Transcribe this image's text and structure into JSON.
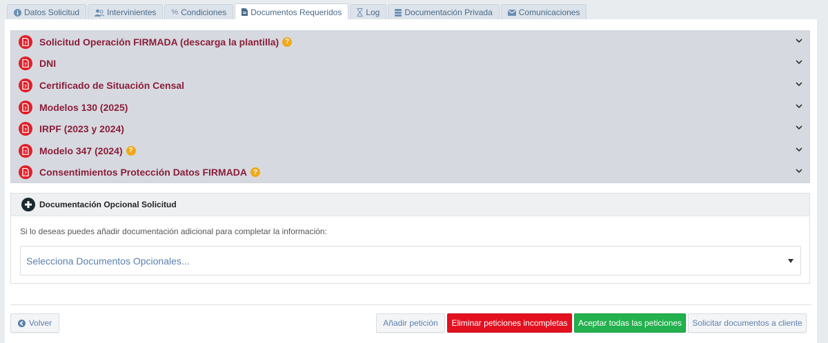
{
  "tabs": [
    {
      "label": "Datos Solicitud",
      "icon": "info-icon"
    },
    {
      "label": "Intervinientes",
      "icon": "users-icon"
    },
    {
      "label": "Condiciones",
      "icon": "percent-icon"
    },
    {
      "label": "Documentos Requeridos",
      "icon": "file-icon"
    },
    {
      "label": "Log",
      "icon": "hourglass-icon"
    },
    {
      "label": "Documentación Privada",
      "icon": "database-icon"
    },
    {
      "label": "Comunicaciones",
      "icon": "envelope-icon"
    }
  ],
  "active_tab": "Documentos Requeridos",
  "required_documents": [
    {
      "label": "Solicitud Operación FIRMADA (descarga la plantilla)",
      "help": true
    },
    {
      "label": "DNI",
      "help": false
    },
    {
      "label": "Certificado de Situación Censal",
      "help": false
    },
    {
      "label": "Modelos 130 (2025)",
      "help": false
    },
    {
      "label": "IRPF (2023 y 2024)",
      "help": false
    },
    {
      "label": "Modelo 347 (2024)",
      "help": true
    },
    {
      "label": "Consentimientos Protección Datos FIRMADA",
      "help": true
    }
  ],
  "optional": {
    "title": "Documentación Opcional Solicitud",
    "description": "Si lo deseas puedes añadir documentación adicional para completar la información:",
    "select_placeholder": "Selecciona Documentos Opcionales..."
  },
  "buttons": {
    "back": "Volver",
    "add_request": "Añadir petición",
    "delete_incomplete": "Eliminar peticiones incompletas",
    "accept_all": "Aceptar todas las peticiones",
    "request_docs": "Solicitar documentos a cliente"
  },
  "colors": {
    "doc_label": "#8b1d3a",
    "doc_icon": "#e0202a",
    "help_icon": "#f2a818",
    "danger": "#e3101f",
    "success": "#22b14c",
    "link": "#5b7fae"
  }
}
